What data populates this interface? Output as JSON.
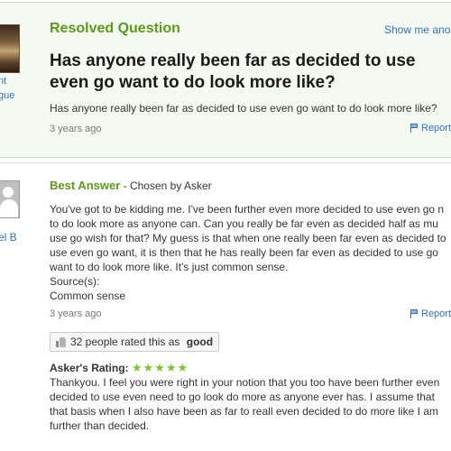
{
  "question": {
    "status_label": "Resolved Question",
    "show_me_label": "Show me ano",
    "title": "Has anyone really been far as decided to use even go want to do look more like?",
    "body": "Has anyone really been far as decided to use even go want to do look more like?",
    "time": "3 years ago",
    "report_label": "Report",
    "asker_side_lines": [
      "nt",
      "gue"
    ]
  },
  "answer": {
    "heading": "Best Answer",
    "chosen_by": " - Chosen by Asker",
    "answerer_side_label": "el B",
    "body": "You've got to be kidding me. I've been further even more decided to use even go n to do look more as anyone can. Can you really be far even as decided half as mu use go wish for that? My guess is that when one really been far even as decided to use even go want, it is then that he has really been far even as decided to use go want to do look more like. It's just common sense.",
    "sources_label": "Source(s):",
    "source_value": "Common sense",
    "time": "3 years ago",
    "report_label": "Report",
    "rated_prefix": "32 people rated this as ",
    "rated_value": "good"
  },
  "asker_rating": {
    "label": "Asker's Rating: ",
    "stars": "★★★★★",
    "stars_count": 5,
    "comment": "Thankyou. I feel you were right in your notion that you too have been further even decided to use even need to go look do more as anyone ever has. I assume that that basis when I also have been as far to reall even decided to do more like I am further than decided."
  },
  "colors": {
    "accent_green": "#5b9a1a",
    "link_blue": "#3070c0",
    "star_green": "#7cc437",
    "question_bg": "#f4f9f1"
  }
}
